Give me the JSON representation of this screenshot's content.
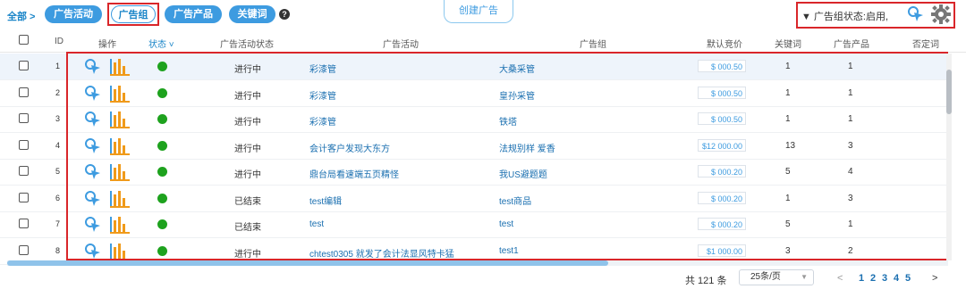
{
  "breadcrumb": "全部 >",
  "tabs": [
    {
      "label": "广告活动"
    },
    {
      "label": "广告组"
    },
    {
      "label": "广告产品"
    },
    {
      "label": "关键词"
    }
  ],
  "help_icon": "?",
  "create_button": "创建广告",
  "filter": {
    "icon": "funnel-icon",
    "label": "广告组状态:启用,"
  },
  "columns": {
    "id": "ID",
    "action": "操作",
    "status": "状态",
    "campaign_status": "广告活动状态",
    "campaign": "广告活动",
    "ad_group": "广告组",
    "default_bid": "默认竞价",
    "keywords": "关键词",
    "products": "广告产品",
    "negative_keywords": "否定词"
  },
  "rows": [
    {
      "id": "1",
      "campaign_status": "进行中",
      "campaign": "彩漆管",
      "ad_group": "大桑采管",
      "bid": "$ 000.50",
      "keywords": "1",
      "products": "1"
    },
    {
      "id": "2",
      "campaign_status": "进行中",
      "campaign": "彩漆管",
      "ad_group": "皇孙采管",
      "bid": "$ 000.50",
      "keywords": "1",
      "products": "1"
    },
    {
      "id": "3",
      "campaign_status": "进行中",
      "campaign": "彩漆管",
      "ad_group": "铁塔",
      "bid": "$ 000.50",
      "keywords": "1",
      "products": "1"
    },
    {
      "id": "4",
      "campaign_status": "进行中",
      "campaign": "会计客户发现大东方",
      "ad_group": "法规别样 爱香",
      "bid": "$12 000.00",
      "keywords": "13",
      "products": "3"
    },
    {
      "id": "5",
      "campaign_status": "进行中",
      "campaign": "鼎台局看速端五页精怪",
      "ad_group": "我US避题题",
      "bid": "$ 000.20",
      "keywords": "5",
      "products": "4"
    },
    {
      "id": "6",
      "campaign_status": "已结束",
      "campaign": "test编辑",
      "ad_group": "test商品",
      "bid": "$ 000.20",
      "keywords": "1",
      "products": "3"
    },
    {
      "id": "7",
      "campaign_status": "已结束",
      "campaign": "test",
      "ad_group": "test",
      "bid": "$ 000.20",
      "keywords": "5",
      "products": "1"
    },
    {
      "id": "8",
      "campaign_status": "进行中",
      "campaign": "chtest0305 就发了会计法显风特卡猛",
      "ad_group": "test1",
      "bid": "$1 000.00",
      "keywords": "3",
      "products": "2"
    }
  ],
  "pagination": {
    "total": "共 121 条",
    "page_size": "25条/页",
    "prev": "<",
    "pages": [
      "1",
      "2",
      "3",
      "4",
      "5"
    ],
    "next": ">"
  },
  "colors": {
    "accent": "#3d9be0",
    "highlight": "#d9262a",
    "status_active": "#1ea21e"
  }
}
